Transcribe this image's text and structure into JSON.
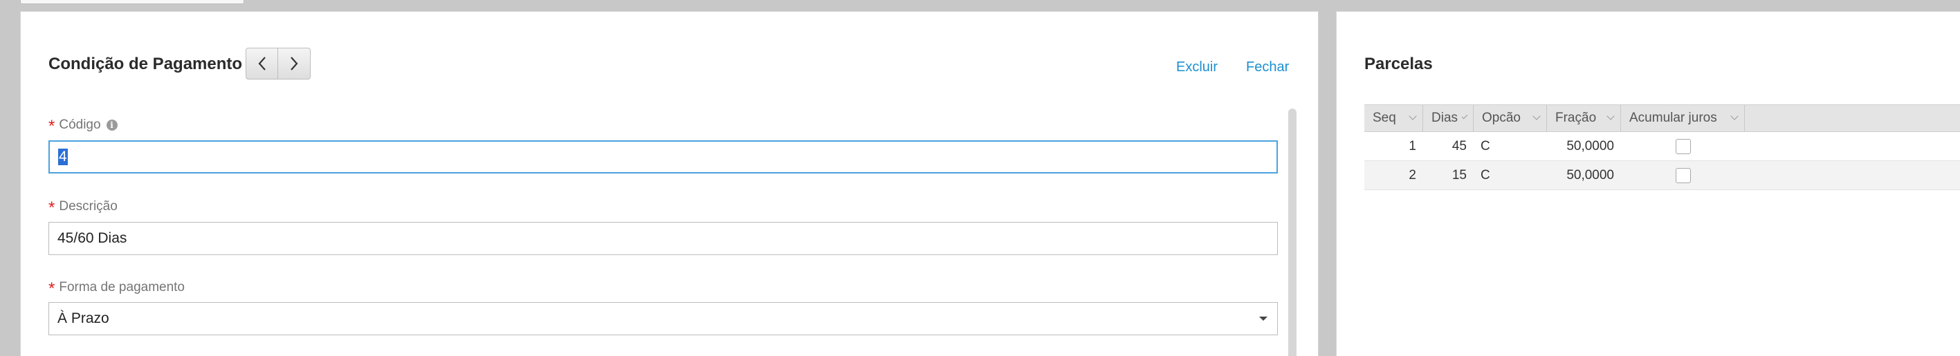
{
  "form": {
    "title": "Condição de Pagamento",
    "actions": {
      "delete": "Excluir",
      "close": "Fechar"
    },
    "fields": {
      "codigo": {
        "label": "Código",
        "value": "4"
      },
      "descricao": {
        "label": "Descrição",
        "value": "45/60 Dias"
      },
      "forma_pagamento": {
        "label": "Forma de pagamento",
        "value": "À Prazo"
      }
    },
    "required_mark": "*",
    "info_icon_glyph": "i"
  },
  "parcelas": {
    "title": "Parcelas",
    "columns": [
      "Seq",
      "Dias",
      "Opcão",
      "Fração",
      "Acumular juros"
    ],
    "rows": [
      {
        "seq": "1",
        "dias": "45",
        "opcao": "C",
        "fracao": "50,0000",
        "acumular": false
      },
      {
        "seq": "2",
        "dias": "15",
        "opcao": "C",
        "fracao": "50,0000",
        "acumular": false
      }
    ]
  },
  "colors": {
    "accent": "#1a8fd0",
    "required": "#e02020",
    "focus": "#4aa3df"
  },
  "icons": {
    "prev": "chevron-left-icon",
    "next": "chevron-right-icon",
    "info": "info-icon",
    "dropdown": "caret-down-icon"
  }
}
